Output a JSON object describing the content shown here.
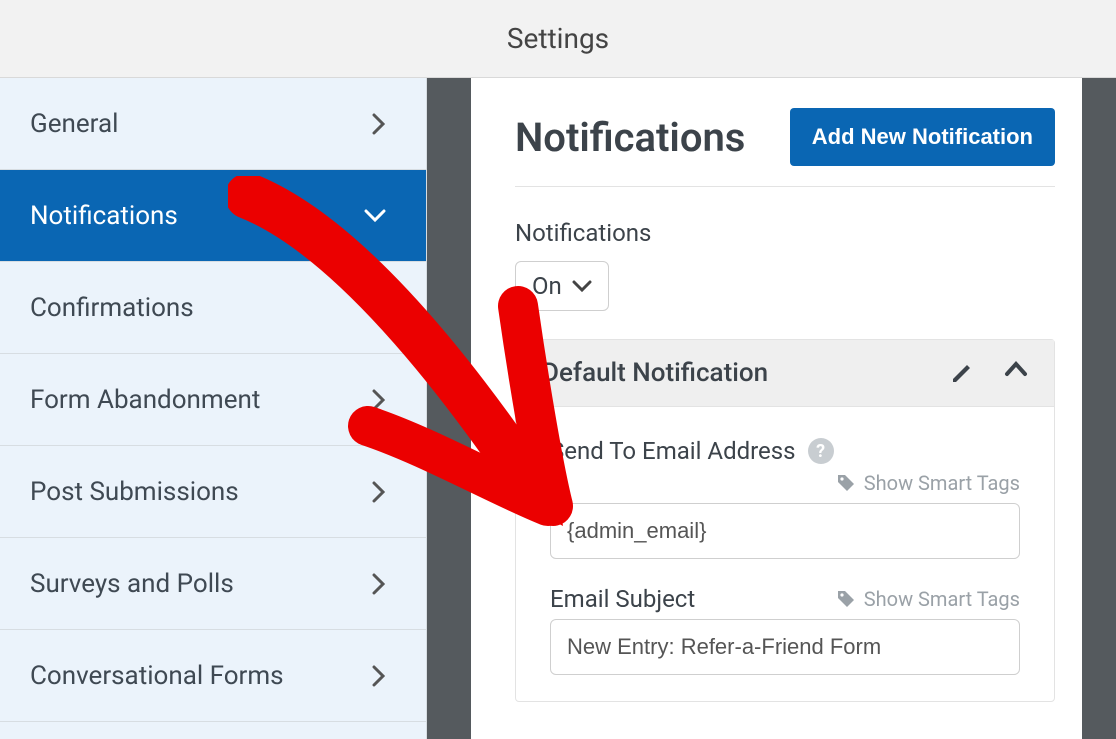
{
  "header": {
    "title": "Settings"
  },
  "sidebar": {
    "items": [
      {
        "label": "General"
      },
      {
        "label": "Notifications"
      },
      {
        "label": "Confirmations"
      },
      {
        "label": "Form Abandonment"
      },
      {
        "label": "Post Submissions"
      },
      {
        "label": "Surveys and Polls"
      },
      {
        "label": "Conversational Forms"
      }
    ]
  },
  "main": {
    "heading": "Notifications",
    "add_button": "Add New Notification",
    "toggle_label": "Notifications",
    "toggle_value": "On",
    "card": {
      "title": "Default Notification",
      "send_to_label": "Send To Email Address",
      "smart_tags_label": "Show Smart Tags",
      "send_to_value": "{admin_email}",
      "subject_label": "Email Subject",
      "subject_value": "New Entry: Refer-a-Friend Form"
    }
  }
}
